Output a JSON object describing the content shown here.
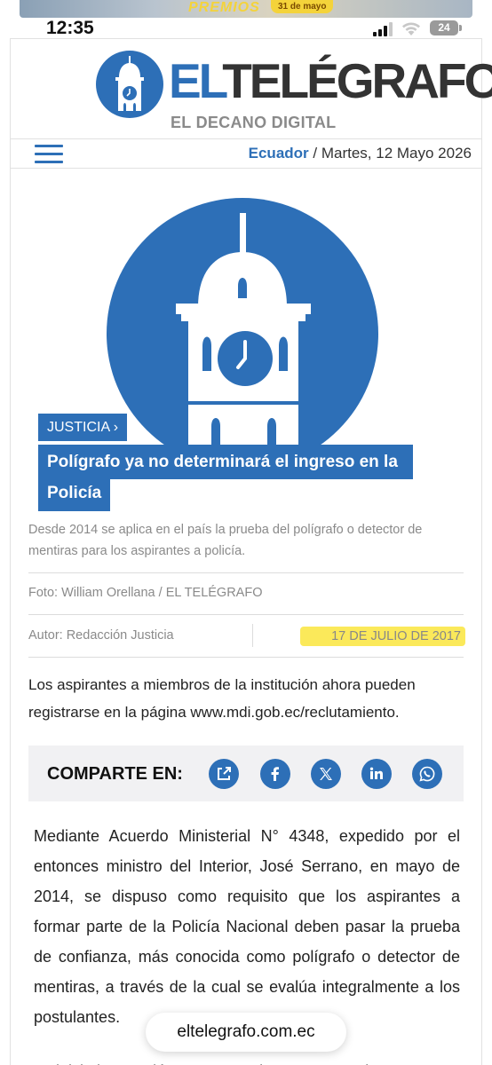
{
  "ad": {
    "text": "PREMIOS",
    "pill": "31 de mayo"
  },
  "status_bar": {
    "time": "12:35",
    "battery": "24"
  },
  "header": {
    "brand": "TELÉGRAFO",
    "brand_prefix": "EL",
    "tagline": "EL DECANO DIGITAL",
    "country": "Ecuador",
    "date": " / Martes, 12 Mayo 2026"
  },
  "article": {
    "section": "JUSTICIA",
    "headline_line1": "Polígrafo ya no determinará el ingreso en la",
    "headline_line2": "Policía",
    "caption": "Desde 2014 se aplica en el país la prueba del polígrafo o detector de mentiras para los aspirantes a policía.",
    "photo_credit": "Foto: William Orellana / EL TELÉGRAFO",
    "author": "Autor: Redacción Justicia",
    "date": "17 DE JULIO DE 2017",
    "summary": "Los aspirantes a miembros de la institución ahora pueden registrarse en la página www.mdi.gob.ec/reclutamiento.",
    "body": "Mediante Acuerdo Ministerial N° 4348, expedido por el entonces ministro del Interior, José Serrano, en mayo de 2014, se dispuso como requisito que los aspirantes a formar parte de la Policía Nacional deben pasar la prueba de confianza, más conocida como polígrafo o detector de mentiras, a través de la cual se evalúa integralmente a los postulantes.",
    "body_next": "La iniciativa surgió como parte de una estrategia"
  },
  "share": {
    "label": "COMPARTE EN:",
    "icons": [
      "share-external-icon",
      "facebook-icon",
      "x-icon",
      "linkedin-icon",
      "whatsapp-icon"
    ]
  },
  "browser": {
    "url": "eltelegrafo.com.ec"
  },
  "colors": {
    "brand_blue": "#2d6fb7",
    "highlight": "#fbe95a"
  }
}
